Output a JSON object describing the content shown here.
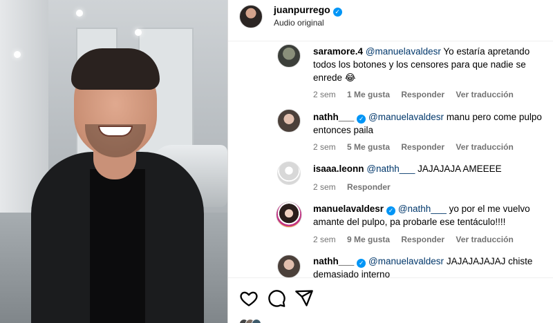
{
  "post": {
    "username": "juanpurrego",
    "subtitle": "Audio original",
    "verified": true
  },
  "comments": [
    {
      "user": "saramore.4",
      "mention": "@manuelavaldesr",
      "text": " Yo estaría apretando todos los botones y los censores para que nadie se enrede 😂",
      "time": "2 sem",
      "likes": "1 Me gusta",
      "reply": "Responder",
      "translate": "Ver traducción"
    },
    {
      "user": "nathh___",
      "verified": true,
      "mention": "@manuelavaldesr",
      "text": " manu pero come pulpo entonces paila",
      "time": "2 sem",
      "likes": "5 Me gusta",
      "reply": "Responder",
      "translate": "Ver traducción"
    },
    {
      "user": "isaaa.leonn",
      "mention": "@nathh___",
      "text": " JAJAJAJA AMEEEE",
      "time": "2 sem",
      "reply": "Responder"
    },
    {
      "user": "manuelavaldesr",
      "verified": true,
      "mention": "@nathh___",
      "text": " yo por el me vuelvo amante del pulpo, pa probarle ese tentáculo!!!!",
      "time": "2 sem",
      "likes": "9 Me gusta",
      "reply": "Responder",
      "translate": "Ver traducción"
    },
    {
      "user": "nathh___",
      "verified": true,
      "mention": "@manuelavaldesr",
      "text": " JAJAJAJAJAJ chiste demasiado interno"
    }
  ],
  "actions": {
    "like_icon": "heart-icon",
    "comment_icon": "comment-icon",
    "share_icon": "share-icon"
  },
  "colors": {
    "verified": "#0095f6",
    "mention": "#00376b",
    "meta": "#737373"
  }
}
